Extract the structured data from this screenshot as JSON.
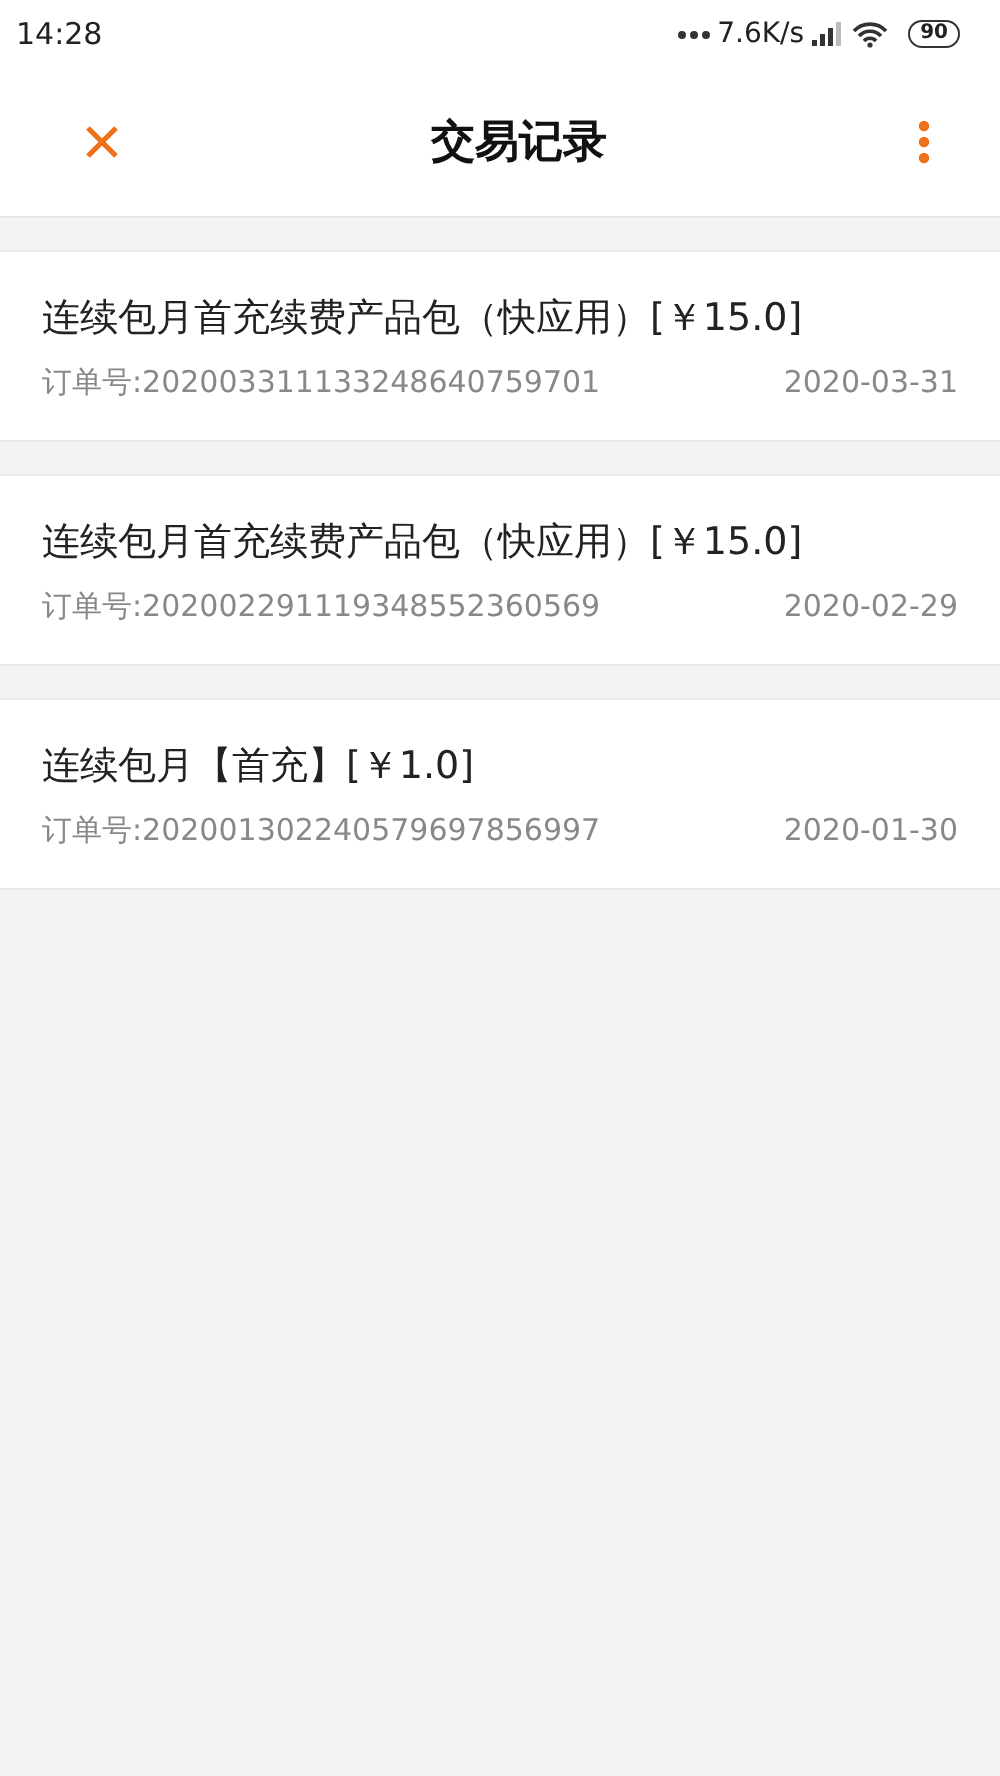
{
  "status_bar": {
    "time": "14:28",
    "speed": "7.6K/s",
    "battery": "90"
  },
  "header": {
    "title": "交易记录"
  },
  "records": [
    {
      "title": "连续包月首充续费产品包（快应用）[￥15.0]",
      "order": "订单号:202003311133248640759701",
      "date": "2020-03-31"
    },
    {
      "title": "连续包月首充续费产品包（快应用）[￥15.0]",
      "order": "订单号:202002291119348552360569",
      "date": "2020-02-29"
    },
    {
      "title": "连续包月【首充】[￥1.0]",
      "order": "订单号:202001302240579697856997",
      "date": "2020-01-30"
    }
  ]
}
